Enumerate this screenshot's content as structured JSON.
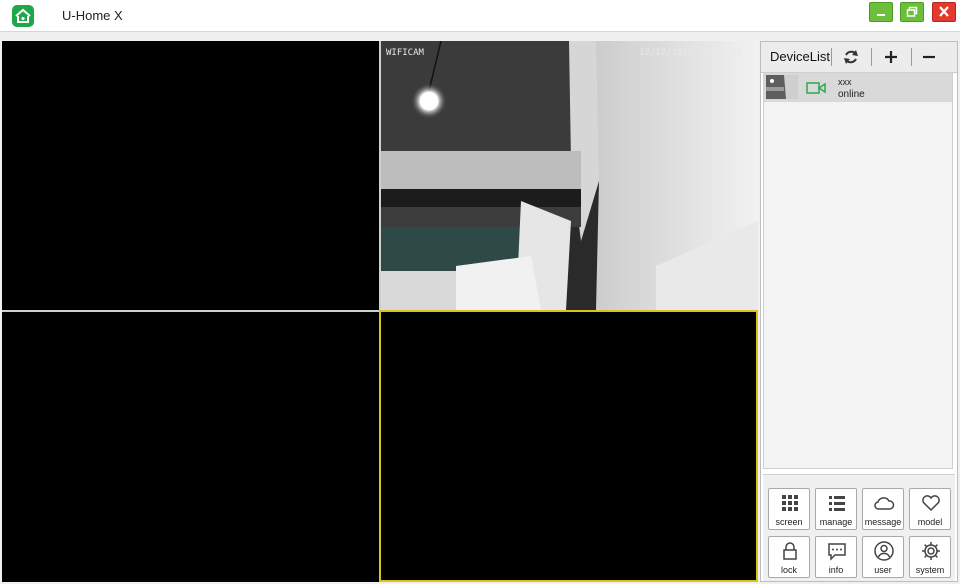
{
  "window": {
    "title": "U-Home X",
    "icon": "house-app-icon",
    "controls": [
      "minimize-icon",
      "restore-icon",
      "close-icon"
    ]
  },
  "video_grid": {
    "layout": "2x2",
    "cells": [
      {
        "index": 1,
        "state": "empty"
      },
      {
        "index": 2,
        "state": "live",
        "label": "WIFICAM",
        "timestamp": "12/12/2016 16:49:05"
      },
      {
        "index": 3,
        "state": "empty"
      },
      {
        "index": 4,
        "state": "empty",
        "selected": true
      }
    ]
  },
  "device_panel": {
    "title": "DeviceList",
    "actions": [
      "refresh-icon",
      "add-icon",
      "remove-icon"
    ],
    "devices": [
      {
        "name": "xxx",
        "status": "online",
        "icon": "camera-icon"
      }
    ]
  },
  "toolbar": {
    "buttons": [
      {
        "label": "screen",
        "icon": "grid-icon"
      },
      {
        "label": "manage",
        "icon": "list-icon"
      },
      {
        "label": "message",
        "icon": "cloud-icon"
      },
      {
        "label": "model",
        "icon": "heart-icon"
      },
      {
        "label": "lock",
        "icon": "lock-icon"
      },
      {
        "label": "info",
        "icon": "chat-icon"
      },
      {
        "label": "user",
        "icon": "user-icon"
      },
      {
        "label": "system",
        "icon": "gear-icon"
      }
    ]
  },
  "colors": {
    "accent_green": "#1ea84a",
    "selected_cell_border": "#d7c41a",
    "close_red": "#e23a2e",
    "camera_online_green": "#2fa84f"
  }
}
